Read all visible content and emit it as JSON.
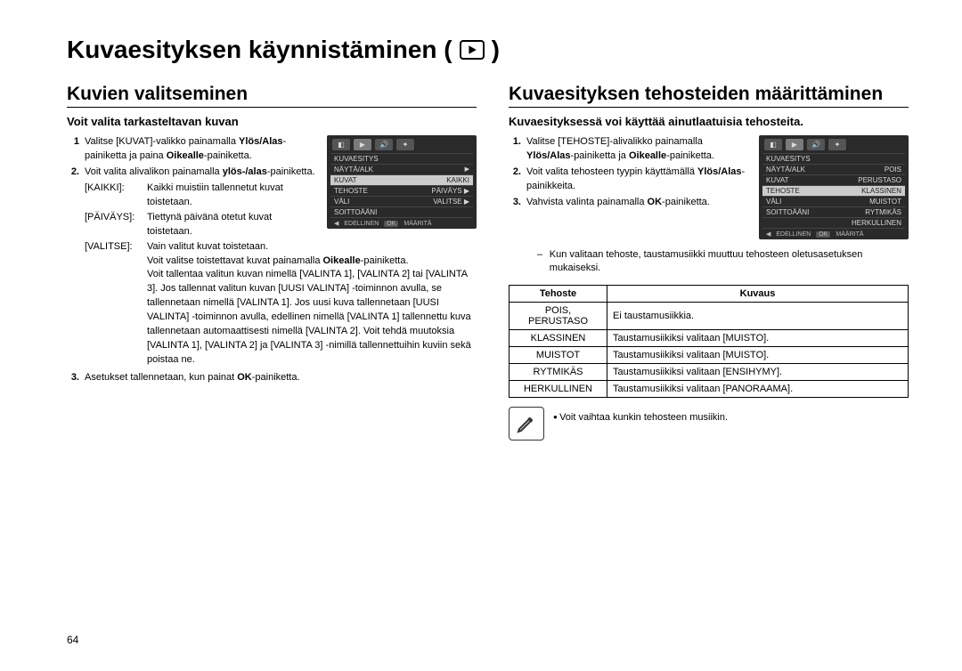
{
  "page": {
    "title": "Kuvaesityksen käynnistäminen (",
    "title_close": ")",
    "number": "64"
  },
  "left": {
    "heading": "Kuvien valitseminen",
    "sub": "Voit valita tarkasteltavan kuvan",
    "step1_num": "1",
    "step1_a": "Valitse [KUVAT]-valikko painamalla ",
    "step1_b": "Ylös/Alas",
    "step1_c": "-painiketta ja paina ",
    "step1_d": "Oikealle",
    "step1_e": "-painiketta.",
    "step2_num": "2.",
    "step2_a": "Voit valita alivalikon painamalla ",
    "step2_b": "ylös-/alas",
    "step2_c": "-painiketta.",
    "def1_key": "[KAIKKI]:",
    "def1_val": "Kaikki muistiin tallennetut kuvat toistetaan.",
    "def2_key": "[PÄIVÄYS]:",
    "def2_val": "Tiettynä päivänä otetut kuvat toistetaan.",
    "def3_key": "[VALITSE]:",
    "def3_val_a": "Vain valitut kuvat toistetaan.",
    "def3_val_b": "Voit valitse toistettavat kuvat painamalla ",
    "def3_val_c": "Oikealle",
    "def3_val_d": "-painiketta.",
    "def3_val_e": "Voit tallentaa valitun kuvan nimellä [VALINTA 1], [VALINTA 2] tai [VALINTA 3]. Jos tallennat valitun kuvan [UUSI VALINTA] -toiminnon avulla, se tallennetaan nimellä [VALINTA 1]. Jos uusi kuva tallennetaan [UUSI VALINTA] -toiminnon avulla, edellinen nimellä [VALINTA 1] tallennettu kuva tallennetaan automaattisesti nimellä [VALINTA 2]. Voit tehdä muutoksia [VALINTA 1], [VALINTA 2] ja [VALINTA 3] -nimillä tallennettuihin kuviin sekä poistaa ne.",
    "step3_num": "3.",
    "step3_a": "Asetukset tallennetaan, kun painat ",
    "step3_b": "OK",
    "step3_c": "-painiketta.",
    "lcd": {
      "title": "KUVAESITYS",
      "r1_l": "NÄYTÄ/ALK",
      "r1_r": "",
      "r2_l": "KUVAT",
      "r2_r": "KAIKKI",
      "r3_l": "TEHOSTE",
      "r3_r": "PÄIVÄYS ▶",
      "r4_l": "VÄLI",
      "r4_r": "VALITSE ▶",
      "r5_l": "SOITTOÄÄNI",
      "r5_r": "",
      "f1": "◀",
      "f2": "EDELLINEN",
      "f3": "OK",
      "f4": "MÄÄRITÄ"
    }
  },
  "right": {
    "heading": "Kuvaesityksen tehosteiden määrittäminen",
    "sub": "Kuvaesityksessä voi käyttää ainutlaatuisia tehosteita.",
    "step1_num": "1.",
    "step1_a": "Valitse [TEHOSTE]-alivalikko painamalla ",
    "step1_b": "Ylös/Alas",
    "step1_c": "-painiketta ja ",
    "step1_d": "Oikealle",
    "step1_e": "-painiketta.",
    "step2_num": "2.",
    "step2_a": "Voit valita tehosteen tyypin käyttämällä ",
    "step2_b": "Ylös/Alas",
    "step2_c": "-painikkeita.",
    "step3_num": "3.",
    "step3_a": "Vahvista valinta painamalla ",
    "step3_b": "OK",
    "step3_c": "-painiketta.",
    "note": "Kun valitaan tehoste, taustamusiikki muuttuu tehosteen oletusasetuksen mukaiseksi.",
    "table": {
      "h1": "Tehoste",
      "h2": "Kuvaus",
      "r1c1a": "POIS,",
      "r1c1b": "PERUSTASO",
      "r1c2": "Ei taustamusiikkia.",
      "r2c1": "KLASSINEN",
      "r2c2": "Taustamusiikiksi valitaan [MUISTO].",
      "r3c1": "MUISTOT",
      "r3c2": "Taustamusiikiksi valitaan [MUISTO].",
      "r4c1": "RYTMIKÄS",
      "r4c2": "Taustamusiikiksi valitaan [ENSIHYMY].",
      "r5c1": "HERKULLINEN",
      "r5c2": "Taustamusiikiksi valitaan [PANORAAMA]."
    },
    "tip": "Voit vaihtaa kunkin tehosteen musiikin.",
    "lcd": {
      "title": "KUVAESITYS",
      "r1_l": "NÄYTÄ/ALK",
      "r1_r": "POIS",
      "r2_l": "KUVAT",
      "r2_r": "PERUSTASO",
      "r3_l": "TEHOSTE",
      "r3_r": "KLASSINEN",
      "r4_l": "VÄLI",
      "r4_r": "MUISTOT",
      "r5_l": "SOITTOÄÄNI",
      "r5_r": "RYTMIKÄS",
      "r6_r": "HERKULLINEN",
      "f1": "◀",
      "f2": "EDELLINEN",
      "f3": "OK",
      "f4": "MÄÄRITÄ"
    }
  }
}
